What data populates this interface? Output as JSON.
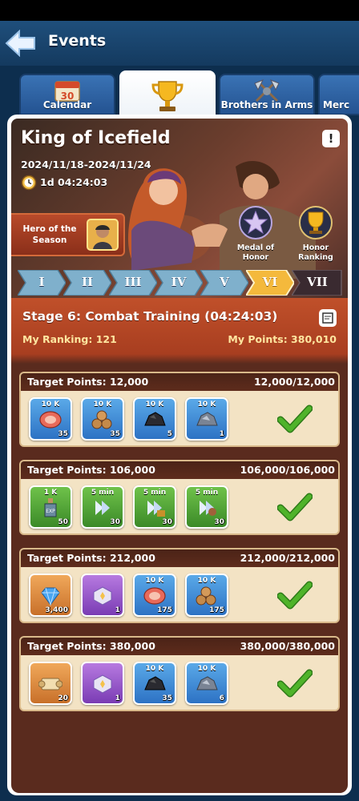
{
  "header": {
    "title": "Events",
    "back_icon": "back-arrow-icon"
  },
  "tabs": [
    {
      "label": "Calendar",
      "icon": "calendar-icon",
      "badge": "30"
    },
    {
      "label": "",
      "icon": "trophy-icon",
      "active": true
    },
    {
      "label": "Brothers in Arms",
      "icon": "crossed-axes-icon"
    },
    {
      "label": "Merc",
      "icon": "mercenary-icon"
    }
  ],
  "event": {
    "title": "King of Icefield",
    "dates": "2024/11/18-2024/11/24",
    "timer": "1d 04:24:03",
    "info_label": "!",
    "hero_label": "Hero of the Season",
    "medals": [
      {
        "label": "Medal of Honor",
        "icon": "medal-of-honor-icon"
      },
      {
        "label": "Honor Ranking",
        "icon": "honor-ranking-trophy-icon"
      }
    ]
  },
  "stages": [
    "I",
    "II",
    "III",
    "IV",
    "V",
    "VI",
    "VII"
  ],
  "stage_info": {
    "title": "Stage 6: Combat Training (04:24:03)",
    "ranking_label": "My Ranking: 121",
    "points_label": "My Points: 380,010"
  },
  "rewards": [
    {
      "target": "Target Points: 12,000",
      "progress": "12,000/12,000",
      "items": [
        {
          "icon": "meat-icon",
          "top": "10 K",
          "count": "35",
          "color": "blue"
        },
        {
          "icon": "wood-logs-icon",
          "top": "10 K",
          "count": "35",
          "color": "blue"
        },
        {
          "icon": "coal-icon",
          "top": "10 K",
          "count": "5",
          "color": "blue"
        },
        {
          "icon": "iron-ore-icon",
          "top": "10 K",
          "count": "1",
          "color": "blue"
        }
      ]
    },
    {
      "target": "Target Points: 106,000",
      "progress": "106,000/106,000",
      "items": [
        {
          "icon": "exp-bottle-icon",
          "top": "1 K",
          "count": "50",
          "color": "green"
        },
        {
          "icon": "speedup-sword-icon",
          "top": "5 min",
          "count": "30",
          "color": "green"
        },
        {
          "icon": "speedup-building-icon",
          "top": "5 min",
          "count": "30",
          "color": "green"
        },
        {
          "icon": "speedup-survivor-icon",
          "top": "5 min",
          "count": "30",
          "color": "green"
        }
      ]
    },
    {
      "target": "Target Points: 212,000",
      "progress": "212,000/212,000",
      "items": [
        {
          "icon": "diamond-icon",
          "top": "",
          "count": "3,400",
          "color": "orange"
        },
        {
          "icon": "hero-shard-icon",
          "top": "",
          "count": "1",
          "color": "purple"
        },
        {
          "icon": "meat-icon",
          "top": "10 K",
          "count": "175",
          "color": "blue"
        },
        {
          "icon": "wood-logs-icon",
          "top": "10 K",
          "count": "175",
          "color": "blue"
        }
      ]
    },
    {
      "target": "Target Points: 380,000",
      "progress": "380,000/380,000",
      "items": [
        {
          "icon": "scroll-icon",
          "top": "",
          "count": "20",
          "color": "orange"
        },
        {
          "icon": "hero-shard-icon",
          "top": "",
          "count": "1",
          "color": "purple"
        },
        {
          "icon": "coal-icon",
          "top": "10 K",
          "count": "35",
          "color": "blue"
        },
        {
          "icon": "iron-ore-icon",
          "top": "10 K",
          "count": "6",
          "color": "blue"
        }
      ]
    }
  ],
  "colors": {
    "accent_orange": "#f0b23a",
    "check_green": "#4fb32a",
    "card_bg": "#f3e3c4"
  }
}
